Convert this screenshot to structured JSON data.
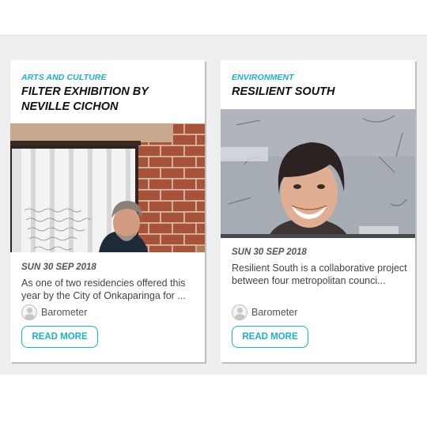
{
  "cards": [
    {
      "category": "ARTS AND CULTURE",
      "title": "FILTER EXHIBITION BY NEVILLE CICHON",
      "date": "SUN 30 SEP 2018",
      "excerpt": "As one of two residencies offered this year by the City of Onkaparinga for ...",
      "author": "Barometer",
      "button": "READ MORE",
      "accent": "#1fb0c6"
    },
    {
      "category": "ENVIRONMENT",
      "title": "RESILIENT SOUTH",
      "date": "SUN 30 SEP 2018",
      "excerpt": "Resilient South is a collaborative project between four metropolitan counci...",
      "author": "Barometer",
      "button": "READ MORE",
      "accent": "#1fb0c6"
    }
  ]
}
